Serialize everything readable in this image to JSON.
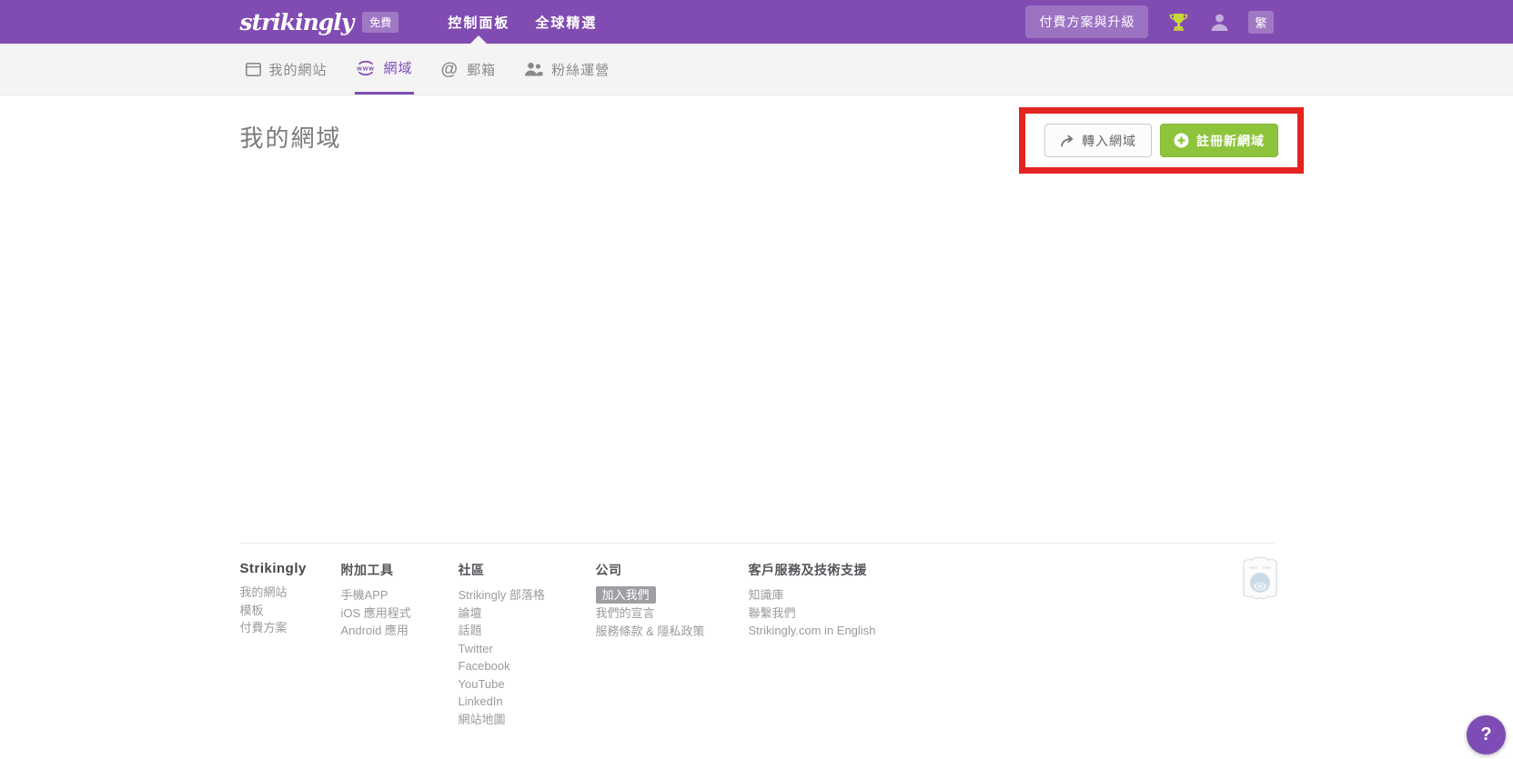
{
  "navbar": {
    "logo": "strikingly",
    "free_badge": "免費",
    "links": {
      "dashboard": "控制面板",
      "discover": "全球精選"
    },
    "upgrade_button": "付費方案與升級",
    "lang_badge": "繁"
  },
  "tabs": {
    "my_sites": "我的網站",
    "domains": "網域",
    "email": "郵箱",
    "audience": "粉絲運營",
    "www_icon_text": "www",
    "at_icon_text": "@"
  },
  "main": {
    "title": "我的網域",
    "transfer_domain_button": "轉入網域",
    "register_domain_button": "註冊新網域"
  },
  "footer": {
    "columns": [
      {
        "header": "Strikingly",
        "items": [
          "我的網站",
          "模板",
          "付費方案"
        ]
      },
      {
        "header": "附加工具",
        "items": [
          "手機APP",
          "iOS 應用程式",
          "Android 應用"
        ]
      },
      {
        "header": "社區",
        "items": [
          "Strikingly 部落格",
          "論壇",
          "話題",
          "Twitter",
          "Facebook",
          "YouTube",
          "LinkedIn",
          "網站地圖"
        ]
      },
      {
        "header": "公司",
        "items": [
          {
            "label": "加入我們",
            "badge": true
          },
          "我們的宣言",
          "服務條款 & 隱私政策"
        ]
      },
      {
        "header": "客戶服務及技術支援",
        "items": [
          "知識庫",
          "聯繫我們",
          "Strikingly.com in English"
        ]
      }
    ]
  },
  "help_button": "?",
  "colors": {
    "navbar_purple": "#814cb2",
    "accent_purple": "#7d4cb5",
    "button_green": "#8ec43c",
    "annotation_red": "#e32421",
    "trophy_lime": "#c9d837"
  }
}
